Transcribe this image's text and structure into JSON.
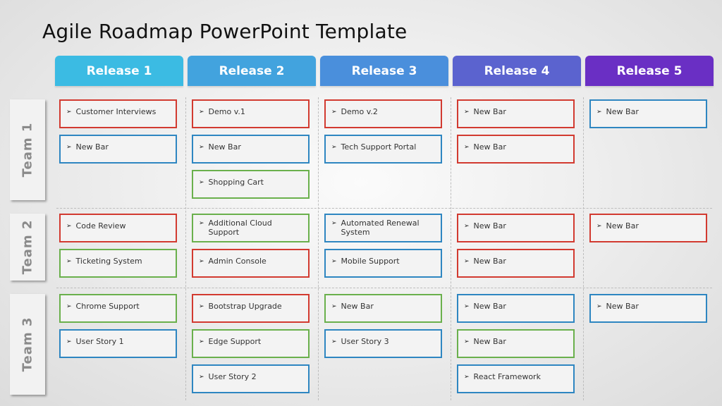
{
  "title": "Agile Roadmap PowerPoint Template",
  "releases": [
    {
      "label": "Release 1",
      "color": "#3bbbe3"
    },
    {
      "label": "Release 2",
      "color": "#42a3de"
    },
    {
      "label": "Release 3",
      "color": "#4a8fdc"
    },
    {
      "label": "Release 4",
      "color": "#5b63cf"
    },
    {
      "label": "Release 5",
      "color": "#6a2fc4"
    }
  ],
  "teams": [
    {
      "label": "Team 1",
      "columns": [
        [
          {
            "text": "Customer Interviews",
            "color": "red"
          },
          {
            "text": "New Bar",
            "color": "blue"
          }
        ],
        [
          {
            "text": "Demo v.1",
            "color": "red"
          },
          {
            "text": "New Bar",
            "color": "blue"
          },
          {
            "text": "Shopping Cart",
            "color": "green"
          }
        ],
        [
          {
            "text": "Demo v.2",
            "color": "red"
          },
          {
            "text": "Tech Support Portal",
            "color": "blue"
          }
        ],
        [
          {
            "text": "New Bar",
            "color": "red"
          },
          {
            "text": "New Bar",
            "color": "red"
          }
        ],
        [
          {
            "text": "New Bar",
            "color": "blue"
          }
        ]
      ]
    },
    {
      "label": "Team 2",
      "columns": [
        [
          {
            "text": "Code Review",
            "color": "red"
          },
          {
            "text": "Ticketing System",
            "color": "green"
          }
        ],
        [
          {
            "text": "Additional Cloud Support",
            "color": "green"
          },
          {
            "text": "Admin Console",
            "color": "red"
          }
        ],
        [
          {
            "text": "Automated Renewal System",
            "color": "blue"
          },
          {
            "text": "Mobile Support",
            "color": "blue"
          }
        ],
        [
          {
            "text": "New Bar",
            "color": "red"
          },
          {
            "text": "New Bar",
            "color": "red"
          }
        ],
        [
          {
            "text": "New Bar",
            "color": "red"
          }
        ]
      ]
    },
    {
      "label": "Team 3",
      "columns": [
        [
          {
            "text": "Chrome Support",
            "color": "green"
          },
          {
            "text": "User Story 1",
            "color": "blue"
          }
        ],
        [
          {
            "text": "Bootstrap Upgrade",
            "color": "red"
          },
          {
            "text": "Edge Support",
            "color": "green"
          },
          {
            "text": "User Story 2",
            "color": "blue"
          }
        ],
        [
          {
            "text": "New Bar",
            "color": "green"
          },
          {
            "text": "User Story 3",
            "color": "blue"
          }
        ],
        [
          {
            "text": "New Bar",
            "color": "blue"
          },
          {
            "text": "New Bar",
            "color": "green"
          },
          {
            "text": "React Framework",
            "color": "blue"
          }
        ],
        [
          {
            "text": "New Bar",
            "color": "blue"
          }
        ]
      ]
    }
  ],
  "bullet_icon": "arrowhead-bullet"
}
